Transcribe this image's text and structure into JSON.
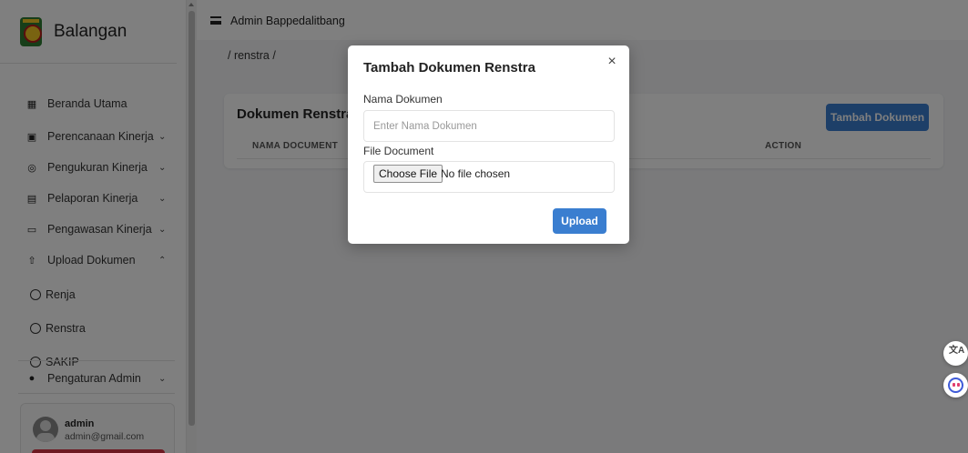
{
  "sidebar": {
    "brand": "Balangan",
    "items": [
      {
        "label": "Beranda Utama",
        "icon": "dashboard-icon"
      },
      {
        "label": "Perencanaan Kinerja",
        "icon": "sitemap-icon"
      },
      {
        "label": "Pengukuran Kinerja",
        "icon": "target-icon"
      },
      {
        "label": "Pelaporan Kinerja",
        "icon": "report-icon"
      },
      {
        "label": "Pengawasan Kinerja",
        "icon": "monitor-icon"
      },
      {
        "label": "Upload Dokumen",
        "icon": "upload-icon"
      },
      {
        "label": "Pengaturan Admin",
        "icon": "users-cog-icon"
      }
    ],
    "sub_items": [
      "Renja",
      "Renstra",
      "SAKIP"
    ],
    "user": {
      "name": "admin",
      "email": "admin@gmail.com"
    }
  },
  "topbar": {
    "title": "Admin Bappedalitbang"
  },
  "breadcrumb": "/ renstra /",
  "card": {
    "title": "Dokumen Renstra",
    "add_button": "Tambah Dokumen",
    "columns": [
      "NAMA DOCUMENT",
      "ACTION"
    ]
  },
  "modal": {
    "title": "Tambah Dokumen Renstra",
    "close": "×",
    "name_label": "Nama Dokumen",
    "name_placeholder": "Enter Nama Dokumen",
    "file_label": "File Document",
    "file_button": "Choose File",
    "file_status": "No file chosen",
    "upload_button": "Upload"
  },
  "floating": {
    "translate_label": "文A"
  },
  "colors": {
    "primary": "#3a7ed0",
    "danger": "#dc3545",
    "overlay": "rgba(0,0,0,0.5)"
  }
}
